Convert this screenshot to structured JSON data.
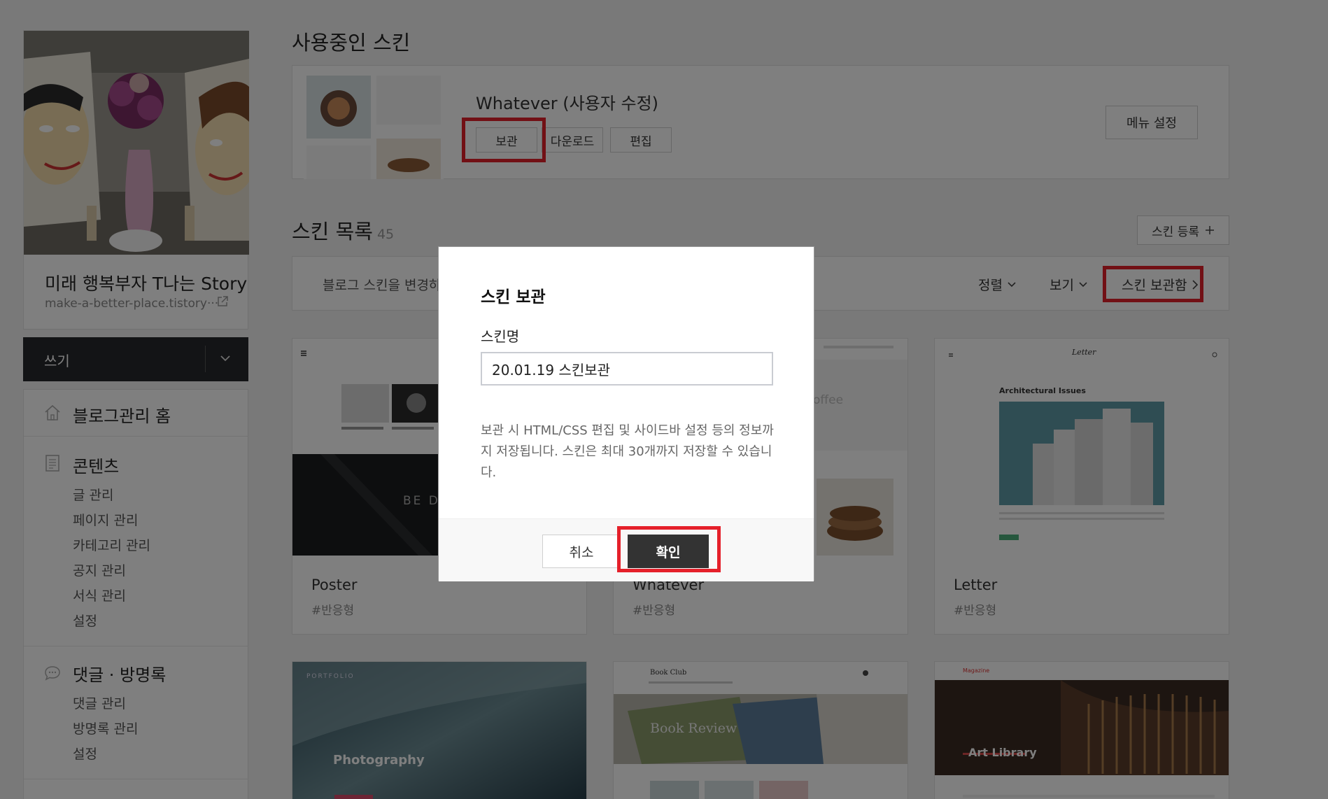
{
  "sidebar": {
    "blog_name": "미래 행복부자 T나는 Story",
    "blog_url": "make-a-better-place.tistory···",
    "write_label": "쓰기",
    "menu": {
      "home": "블로그관리 홈",
      "contents": {
        "title": "콘텐츠",
        "items": [
          "글 관리",
          "페이지 관리",
          "카테고리 관리",
          "공지 관리",
          "서식 관리",
          "설정"
        ]
      },
      "comments": {
        "title": "댓글 · 방명록",
        "items": [
          "댓글 관리",
          "방명록 관리",
          "설정"
        ]
      }
    }
  },
  "current_skin": {
    "section_title": "사용중인 스킨",
    "name": "Whatever (사용자 수정)",
    "buttons": {
      "archive": "보관",
      "download": "다운로드",
      "edit": "편집",
      "menu_settings": "메뉴 설정"
    }
  },
  "skin_list": {
    "title": "스킨 목록",
    "count": "45",
    "register": "스킨 등록",
    "filter_desc": "블로그 스킨을 변경하",
    "sort": "정렬",
    "view": "보기",
    "archive_box": "스킨 보관함",
    "cards": [
      {
        "name": "Poster",
        "tag": "#반응형",
        "overlay_text": "BE DI"
      },
      {
        "name": "Whatever",
        "tag": "#반응형",
        "overlay_text": "offee"
      },
      {
        "name": "Letter",
        "tag": "#반응형",
        "header": "Letter",
        "heading": "Architectural Issues"
      }
    ],
    "cards_row2": [
      {
        "label": "PORTFOLIO",
        "title": "Photography"
      },
      {
        "header": "Book Club",
        "title": "Book Review"
      },
      {
        "header": "Magazine",
        "title": "Art Library"
      }
    ]
  },
  "modal": {
    "title": "스킨 보관",
    "field_label": "스킨명",
    "input_value": "20.01.19 스킨보관",
    "description": "보관 시 HTML/CSS 편집 및 사이드바 설정 등의 정보까지 저장됩니다. 스킨은 최대 30개까지 저장할 수 있습니다.",
    "cancel": "취소",
    "confirm": "확인"
  },
  "colors": {
    "highlight": "#e5202a",
    "dark_button": "#333333",
    "overlay": "rgba(0,0,0,0.5)"
  }
}
